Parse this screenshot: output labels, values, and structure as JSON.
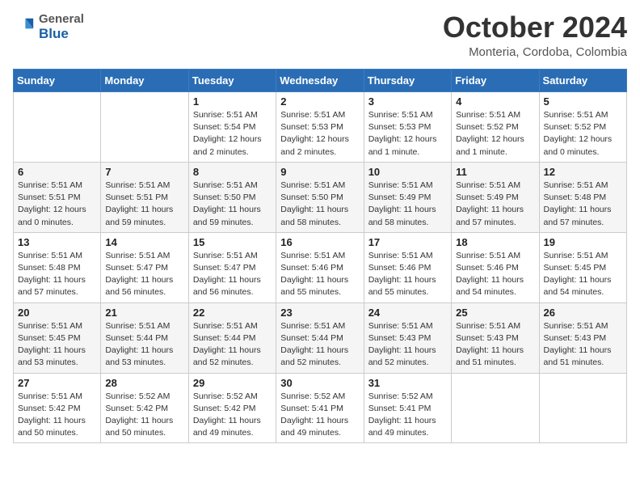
{
  "header": {
    "logo": {
      "general": "General",
      "blue": "Blue"
    },
    "title": "October 2024",
    "location": "Monteria, Cordoba, Colombia"
  },
  "weekdays": [
    "Sunday",
    "Monday",
    "Tuesday",
    "Wednesday",
    "Thursday",
    "Friday",
    "Saturday"
  ],
  "weeks": [
    [
      {
        "day": null,
        "info": null
      },
      {
        "day": null,
        "info": null
      },
      {
        "day": "1",
        "info": "Sunrise: 5:51 AM\nSunset: 5:54 PM\nDaylight: 12 hours\nand 2 minutes."
      },
      {
        "day": "2",
        "info": "Sunrise: 5:51 AM\nSunset: 5:53 PM\nDaylight: 12 hours\nand 2 minutes."
      },
      {
        "day": "3",
        "info": "Sunrise: 5:51 AM\nSunset: 5:53 PM\nDaylight: 12 hours\nand 1 minute."
      },
      {
        "day": "4",
        "info": "Sunrise: 5:51 AM\nSunset: 5:52 PM\nDaylight: 12 hours\nand 1 minute."
      },
      {
        "day": "5",
        "info": "Sunrise: 5:51 AM\nSunset: 5:52 PM\nDaylight: 12 hours\nand 0 minutes."
      }
    ],
    [
      {
        "day": "6",
        "info": "Sunrise: 5:51 AM\nSunset: 5:51 PM\nDaylight: 12 hours\nand 0 minutes."
      },
      {
        "day": "7",
        "info": "Sunrise: 5:51 AM\nSunset: 5:51 PM\nDaylight: 11 hours\nand 59 minutes."
      },
      {
        "day": "8",
        "info": "Sunrise: 5:51 AM\nSunset: 5:50 PM\nDaylight: 11 hours\nand 59 minutes."
      },
      {
        "day": "9",
        "info": "Sunrise: 5:51 AM\nSunset: 5:50 PM\nDaylight: 11 hours\nand 58 minutes."
      },
      {
        "day": "10",
        "info": "Sunrise: 5:51 AM\nSunset: 5:49 PM\nDaylight: 11 hours\nand 58 minutes."
      },
      {
        "day": "11",
        "info": "Sunrise: 5:51 AM\nSunset: 5:49 PM\nDaylight: 11 hours\nand 57 minutes."
      },
      {
        "day": "12",
        "info": "Sunrise: 5:51 AM\nSunset: 5:48 PM\nDaylight: 11 hours\nand 57 minutes."
      }
    ],
    [
      {
        "day": "13",
        "info": "Sunrise: 5:51 AM\nSunset: 5:48 PM\nDaylight: 11 hours\nand 57 minutes."
      },
      {
        "day": "14",
        "info": "Sunrise: 5:51 AM\nSunset: 5:47 PM\nDaylight: 11 hours\nand 56 minutes."
      },
      {
        "day": "15",
        "info": "Sunrise: 5:51 AM\nSunset: 5:47 PM\nDaylight: 11 hours\nand 56 minutes."
      },
      {
        "day": "16",
        "info": "Sunrise: 5:51 AM\nSunset: 5:46 PM\nDaylight: 11 hours\nand 55 minutes."
      },
      {
        "day": "17",
        "info": "Sunrise: 5:51 AM\nSunset: 5:46 PM\nDaylight: 11 hours\nand 55 minutes."
      },
      {
        "day": "18",
        "info": "Sunrise: 5:51 AM\nSunset: 5:46 PM\nDaylight: 11 hours\nand 54 minutes."
      },
      {
        "day": "19",
        "info": "Sunrise: 5:51 AM\nSunset: 5:45 PM\nDaylight: 11 hours\nand 54 minutes."
      }
    ],
    [
      {
        "day": "20",
        "info": "Sunrise: 5:51 AM\nSunset: 5:45 PM\nDaylight: 11 hours\nand 53 minutes."
      },
      {
        "day": "21",
        "info": "Sunrise: 5:51 AM\nSunset: 5:44 PM\nDaylight: 11 hours\nand 53 minutes."
      },
      {
        "day": "22",
        "info": "Sunrise: 5:51 AM\nSunset: 5:44 PM\nDaylight: 11 hours\nand 52 minutes."
      },
      {
        "day": "23",
        "info": "Sunrise: 5:51 AM\nSunset: 5:44 PM\nDaylight: 11 hours\nand 52 minutes."
      },
      {
        "day": "24",
        "info": "Sunrise: 5:51 AM\nSunset: 5:43 PM\nDaylight: 11 hours\nand 52 minutes."
      },
      {
        "day": "25",
        "info": "Sunrise: 5:51 AM\nSunset: 5:43 PM\nDaylight: 11 hours\nand 51 minutes."
      },
      {
        "day": "26",
        "info": "Sunrise: 5:51 AM\nSunset: 5:43 PM\nDaylight: 11 hours\nand 51 minutes."
      }
    ],
    [
      {
        "day": "27",
        "info": "Sunrise: 5:51 AM\nSunset: 5:42 PM\nDaylight: 11 hours\nand 50 minutes."
      },
      {
        "day": "28",
        "info": "Sunrise: 5:52 AM\nSunset: 5:42 PM\nDaylight: 11 hours\nand 50 minutes."
      },
      {
        "day": "29",
        "info": "Sunrise: 5:52 AM\nSunset: 5:42 PM\nDaylight: 11 hours\nand 49 minutes."
      },
      {
        "day": "30",
        "info": "Sunrise: 5:52 AM\nSunset: 5:41 PM\nDaylight: 11 hours\nand 49 minutes."
      },
      {
        "day": "31",
        "info": "Sunrise: 5:52 AM\nSunset: 5:41 PM\nDaylight: 11 hours\nand 49 minutes."
      },
      {
        "day": null,
        "info": null
      },
      {
        "day": null,
        "info": null
      }
    ]
  ]
}
